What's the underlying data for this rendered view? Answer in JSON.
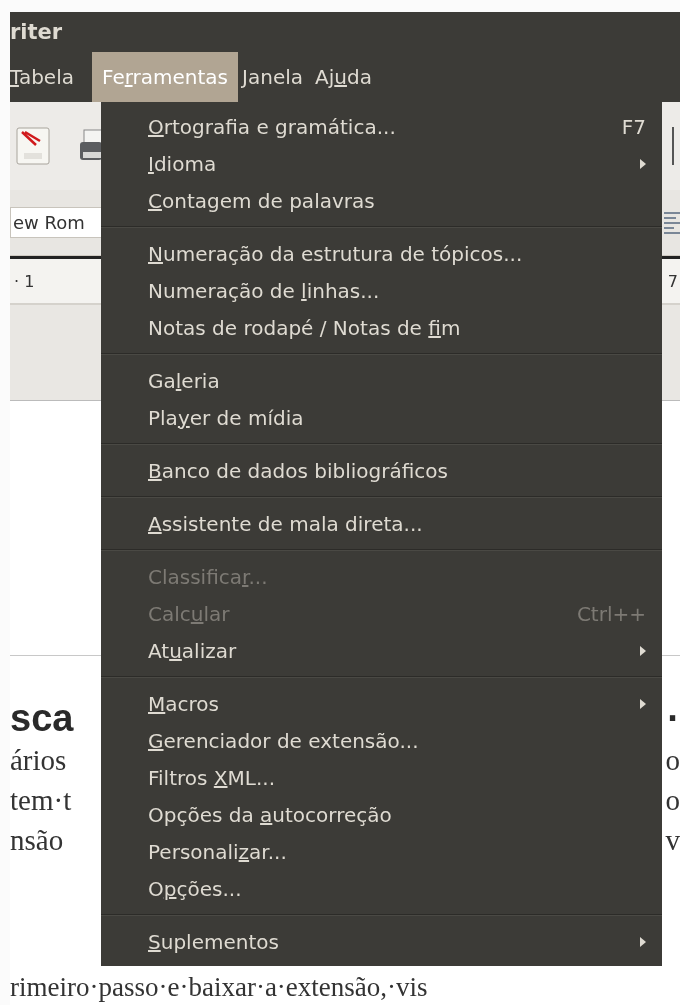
{
  "window": {
    "title": "riter"
  },
  "menubar": [
    {
      "label": {
        "key": "T",
        "post": "abela"
      },
      "selected": false
    },
    {
      "label": {
        "pre": "Fe",
        "key": "r",
        "post": "ramentas"
      },
      "selected": true
    },
    {
      "label": {
        "key": "J",
        "post": "anela"
      },
      "selected": false
    },
    {
      "label": {
        "pre": "Aj",
        "key": "u",
        "post": "da"
      },
      "selected": false
    }
  ],
  "format_bar": {
    "font_name": "ew Rom"
  },
  "ruler": {
    "left_label": "· 1",
    "right_label": "7"
  },
  "menu": {
    "items": [
      {
        "kind": "item",
        "label": {
          "key": "O",
          "post": "rtografia e gramática..."
        },
        "shortcut": "F7",
        "submenu": false,
        "disabled": false
      },
      {
        "kind": "item",
        "label": {
          "key": "I",
          "post": "dioma"
        },
        "submenu": true,
        "disabled": false
      },
      {
        "kind": "item",
        "label": {
          "key": "C",
          "post": "ontagem de palavras"
        },
        "submenu": false,
        "disabled": false
      },
      {
        "kind": "separator"
      },
      {
        "kind": "item",
        "label": {
          "key": "N",
          "post": "umeração da estrutura de tópicos..."
        },
        "submenu": false,
        "disabled": false
      },
      {
        "kind": "item",
        "label": {
          "pre": "Numeração de ",
          "key": "l",
          "post": "inhas..."
        },
        "submenu": false,
        "disabled": false
      },
      {
        "kind": "item",
        "label": {
          "pre": "Notas de rodapé / Notas de ",
          "key": "f",
          "post": "im"
        },
        "submenu": false,
        "disabled": false
      },
      {
        "kind": "separator"
      },
      {
        "kind": "item",
        "label": {
          "pre": "Ga",
          "key": "l",
          "post": "eria"
        },
        "submenu": false,
        "disabled": false
      },
      {
        "kind": "item",
        "label": {
          "pre": "Pla",
          "key": "y",
          "post": "er de mídia"
        },
        "submenu": false,
        "disabled": false
      },
      {
        "kind": "separator"
      },
      {
        "kind": "item",
        "label": {
          "key": "B",
          "post": "anco de dados bibliográficos"
        },
        "submenu": false,
        "disabled": false
      },
      {
        "kind": "separator"
      },
      {
        "kind": "item",
        "label": {
          "key": "A",
          "post": "ssistente de mala direta..."
        },
        "submenu": false,
        "disabled": false
      },
      {
        "kind": "separator"
      },
      {
        "kind": "item",
        "label": {
          "pre": "Classifica",
          "key": "r",
          "post": "..."
        },
        "submenu": false,
        "disabled": true
      },
      {
        "kind": "item",
        "label": {
          "pre": "Calc",
          "key": "u",
          "post": "lar"
        },
        "shortcut": "Ctrl++",
        "submenu": false,
        "disabled": true
      },
      {
        "kind": "item",
        "label": {
          "pre": "At",
          "key": "u",
          "post": "alizar"
        },
        "submenu": true,
        "disabled": false
      },
      {
        "kind": "separator"
      },
      {
        "kind": "item",
        "label": {
          "key": "M",
          "post": "acros"
        },
        "submenu": true,
        "disabled": false
      },
      {
        "kind": "item",
        "label": {
          "key": "G",
          "post": "erenciador de extensão..."
        },
        "submenu": false,
        "disabled": false
      },
      {
        "kind": "item",
        "label": {
          "pre": "Filtros ",
          "key": "X",
          "post": "ML..."
        },
        "submenu": false,
        "disabled": false
      },
      {
        "kind": "item",
        "label": {
          "pre": "Opções da ",
          "key": "a",
          "post": "utocorreção"
        },
        "submenu": false,
        "disabled": false
      },
      {
        "kind": "item",
        "label": {
          "pre": "Personali",
          "key": "z",
          "post": "ar..."
        },
        "submenu": false,
        "disabled": false
      },
      {
        "kind": "item",
        "label": {
          "pre": "O",
          "key": "p",
          "post": "ções..."
        },
        "submenu": false,
        "disabled": false
      },
      {
        "kind": "separator"
      },
      {
        "kind": "item",
        "label": {
          "key": "S",
          "post": "uplementos"
        },
        "submenu": true,
        "disabled": false
      }
    ]
  },
  "document": {
    "heading": {
      "left": "sca",
      "right": "·"
    },
    "lines": [
      {
        "left": "ários",
        "right": "o"
      },
      {
        "left": "tem·t",
        "right": "o"
      },
      {
        "left": "nsão",
        "right": "v"
      }
    ],
    "last_line": "rimeiro·passo·e·baixar·a·extensão,·vis"
  }
}
